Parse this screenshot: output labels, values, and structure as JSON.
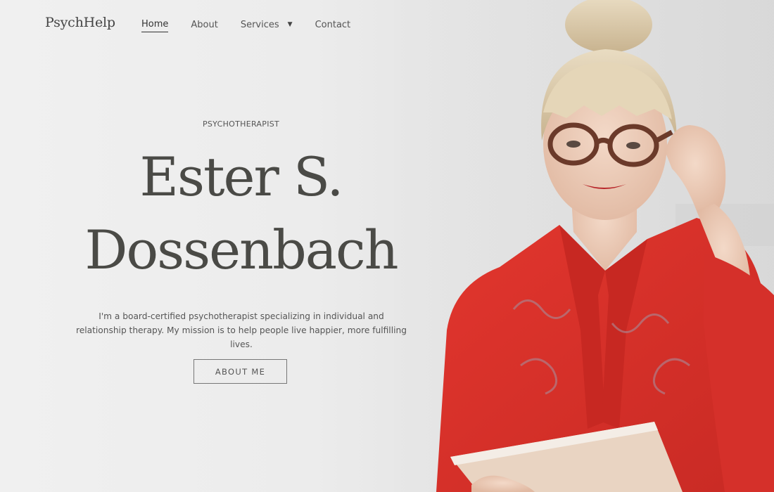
{
  "brand": {
    "logo_text": "PsychHelp"
  },
  "nav": {
    "items": [
      {
        "label": "Home"
      },
      {
        "label": "About"
      },
      {
        "label": "Services"
      },
      {
        "label": "Contact"
      }
    ],
    "active_index": 0,
    "services_caret": "▼"
  },
  "hero": {
    "eyebrow": "PSYCHOTHERAPIST",
    "name_line1": "Ester S.",
    "name_line2": "Dossenbach",
    "intro": "I'm a board-certified psychotherapist specializing in individual and relationship therapy. My mission is to help people live happier, more fulfilling lives.",
    "cta_label": "ABOUT ME"
  },
  "colors": {
    "text": "#444444",
    "heading": "#4a4a46",
    "background": "#ececec",
    "accent_red": "#d8322b"
  },
  "icons": {
    "dropdown": "chevron-down-icon"
  }
}
